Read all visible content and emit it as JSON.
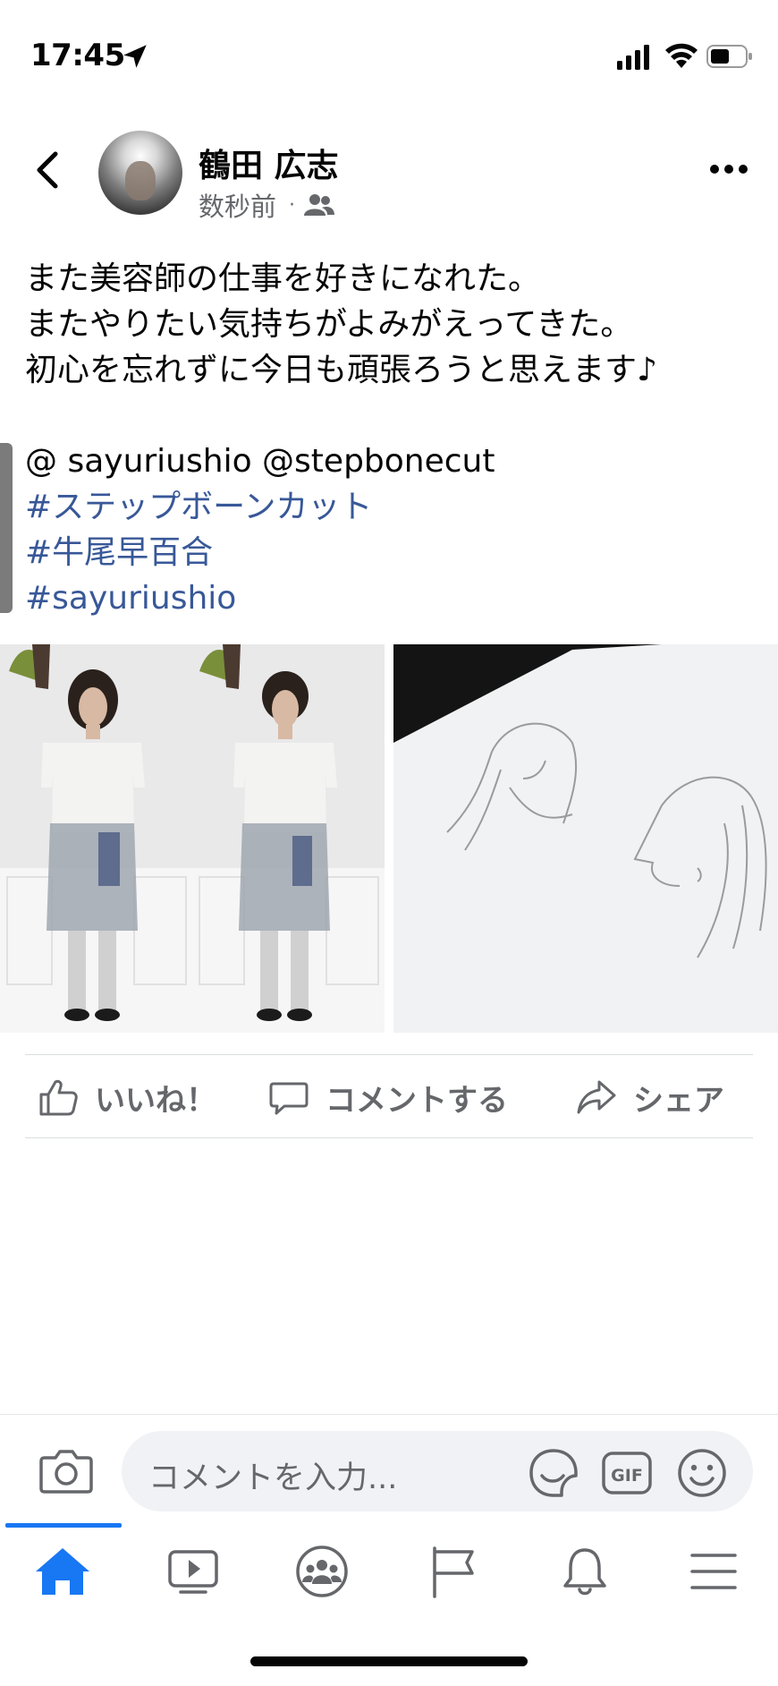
{
  "status_bar": {
    "time": "17:45",
    "icons": [
      "location-arrow-icon",
      "cellular-signal-icon",
      "wifi-icon",
      "battery-icon"
    ]
  },
  "post": {
    "author": "鶴田 広志",
    "timestamp": "数秒前",
    "meta_separator": "·",
    "audience_icon": "friends-icon",
    "lines": [
      "また美容師の仕事を好きになれた。",
      "またやりたい気持ちがよみがえってきた。",
      "初心を忘れずに今日も頑張ろうと思えます♪"
    ],
    "mentions": "@ sayuriushio @stepbonecut",
    "hashtags": [
      "#ステップボーンカット",
      "#牛尾早百合",
      "#sayuriushio"
    ]
  },
  "actions": {
    "like": "いいね！",
    "comment": "コメントする",
    "share": "シェア"
  },
  "comment_bar": {
    "placeholder": "コメントを入力...",
    "gif": "GIF"
  },
  "tab_bar": {
    "active": "home",
    "tabs": [
      "home-icon",
      "watch-icon",
      "groups-icon",
      "pages-flag-icon",
      "notifications-bell-icon",
      "menu-icon"
    ]
  },
  "colors": {
    "accent": "#1877f2",
    "hashtag": "#385898",
    "secondary_text": "#65676b"
  }
}
